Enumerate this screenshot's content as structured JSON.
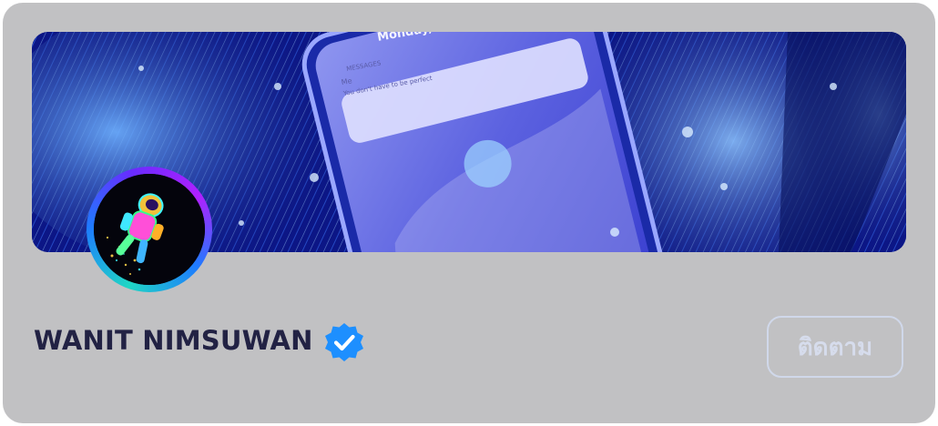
{
  "profile": {
    "name": "WANIT NIMSUWAN",
    "verified_icon": "verified-badge-icon"
  },
  "cover": {
    "phone_date": "Monday, Se",
    "notification_app": "MESSAGES",
    "notification_sender": "Me",
    "notification_body": "You don't have to be perfect"
  },
  "actions": {
    "follow_label": "ติดตาม"
  },
  "colors": {
    "card_bg": "#c1c1c3",
    "name_text": "#222244",
    "badge_blue": "#1d8fff",
    "follow_text": "#d6dcec"
  }
}
